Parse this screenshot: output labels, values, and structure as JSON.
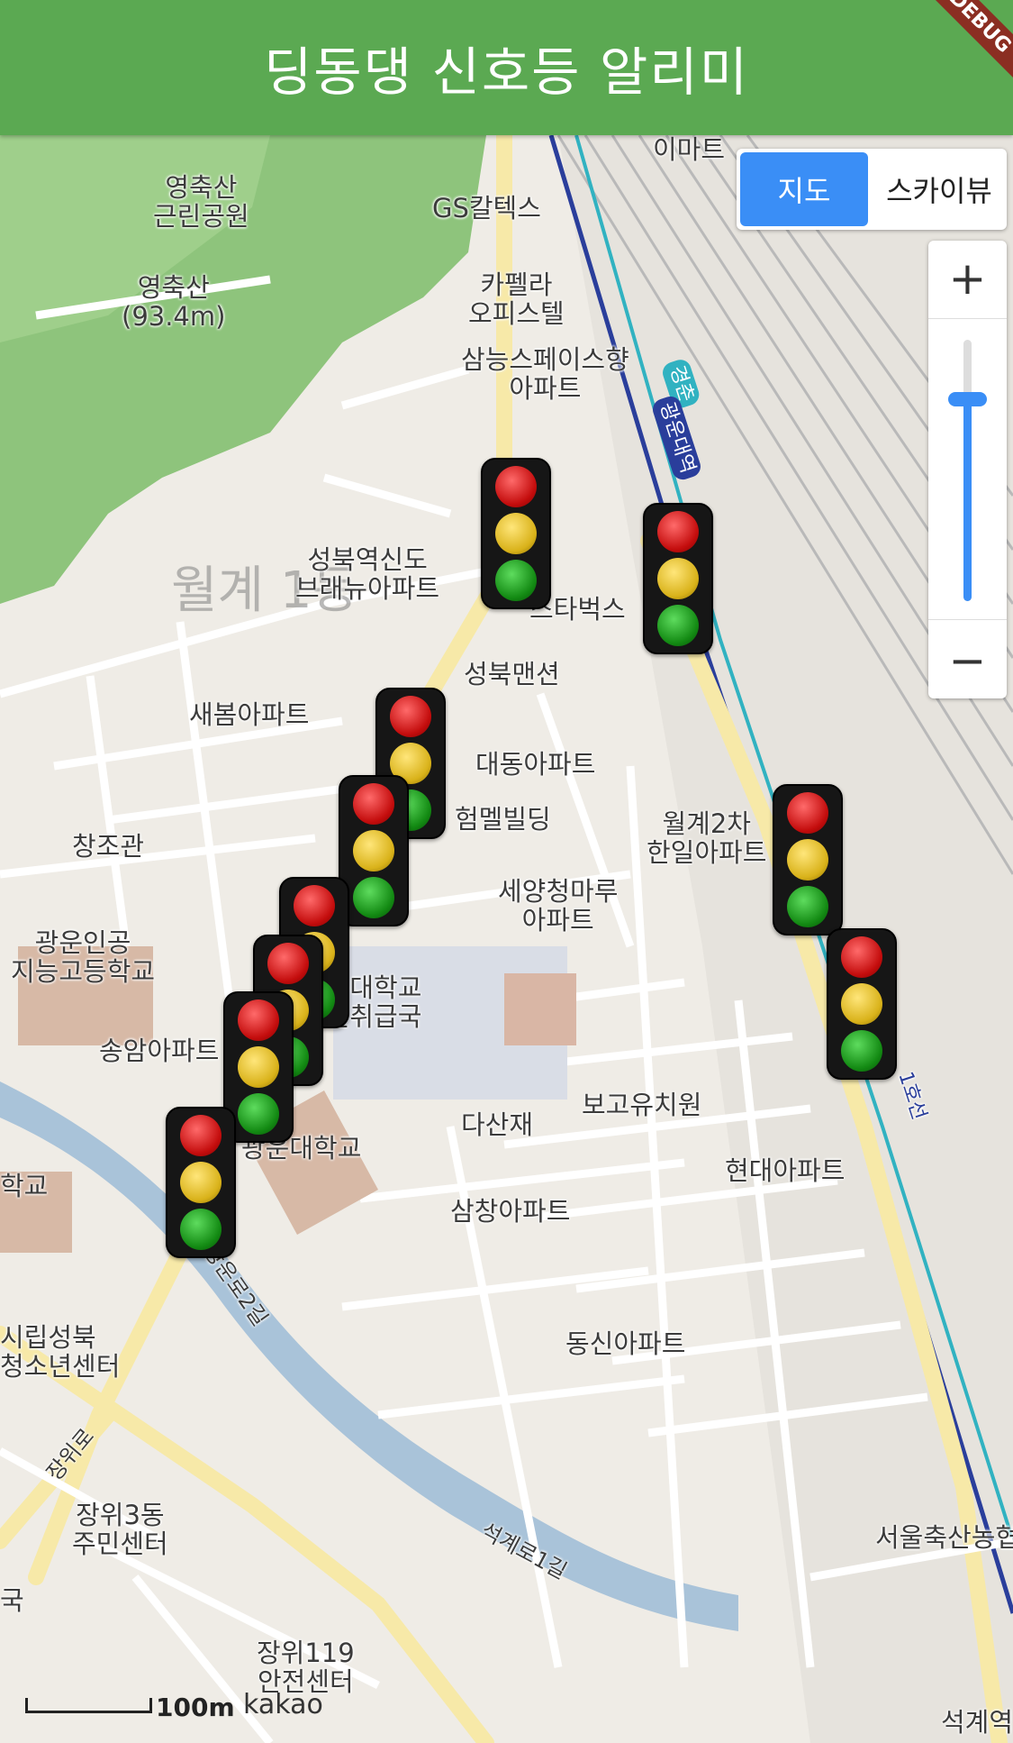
{
  "app": {
    "title": "딩동댕 신호등 알리미",
    "debug_banner": "DEBUG"
  },
  "map_type": {
    "map_label": "지도",
    "skyview_label": "스카이뷰",
    "active": "지도"
  },
  "zoom": {
    "plus": "+",
    "minus": "−"
  },
  "places": [
    {
      "id": "emart",
      "text": "이마트"
    },
    {
      "id": "young-park",
      "text": "영축산\n근린공원"
    },
    {
      "id": "gs",
      "text": "GS칼텍스"
    },
    {
      "id": "young-mt",
      "text": "영축산\n(93.4m)"
    },
    {
      "id": "cafe",
      "text": "카펠라\n오피스텔"
    },
    {
      "id": "samsung",
      "text": "삼능스페이스향\n아파트"
    },
    {
      "id": "brenew",
      "text": "성북역신도\n브래뉴아파트"
    },
    {
      "id": "starbucks",
      "text": "스타벅스"
    },
    {
      "id": "mansion",
      "text": "성북맨션"
    },
    {
      "id": "saebom",
      "text": "새봄아파트"
    },
    {
      "id": "daedong",
      "text": "대동아파트"
    },
    {
      "id": "hummel",
      "text": "험멜빌딩"
    },
    {
      "id": "wolgye2",
      "text": "월계2차\n한일아파트"
    },
    {
      "id": "changjo",
      "text": "창조관"
    },
    {
      "id": "seyang",
      "text": "세양청마루\n아파트"
    },
    {
      "id": "kwangwoon-ai",
      "text": "광운인공\n지능고등학교"
    },
    {
      "id": "kw-post",
      "text": "광운대학교\n우편취급국"
    },
    {
      "id": "songam",
      "text": "송암아파트"
    },
    {
      "id": "kw-univ",
      "text": "광운대학교"
    },
    {
      "id": "dasan",
      "text": "다산재"
    },
    {
      "id": "bogo",
      "text": "보고유치원"
    },
    {
      "id": "school",
      "text": "학교"
    },
    {
      "id": "hyundai",
      "text": "현대아파트"
    },
    {
      "id": "samchang",
      "text": "삼창아파트"
    },
    {
      "id": "seongbuk-youth",
      "text": "시립성북\n청소년센터"
    },
    {
      "id": "dongshin",
      "text": "동신아파트"
    },
    {
      "id": "jangwi-road",
      "text": "장위로"
    },
    {
      "id": "jangwi3",
      "text": "장위3동\n주민센터"
    },
    {
      "id": "seokgye",
      "text": "석계로1길"
    },
    {
      "id": "kwangwoon-ro",
      "text": "광운로2길"
    },
    {
      "id": "chuksan",
      "text": "서울축산농협"
    },
    {
      "id": "guk",
      "text": "국"
    },
    {
      "id": "jangwi119",
      "text": "장위119\n안전센터"
    },
    {
      "id": "seokgye-stn",
      "text": "석계역"
    },
    {
      "id": "wolgye-dong",
      "text": "월계 1동"
    },
    {
      "id": "gyeongchun",
      "text": "경춘"
    },
    {
      "id": "kw-stn",
      "text": "광운대역"
    },
    {
      "id": "line1",
      "text": "1호선"
    }
  ],
  "scale": {
    "text": "100m"
  },
  "attribution": "kakao",
  "traffic_lights": [
    {
      "id": "tl-1",
      "lamps": [
        "red",
        "yellow",
        "green"
      ]
    },
    {
      "id": "tl-2",
      "lamps": [
        "red",
        "yellow",
        "green"
      ]
    },
    {
      "id": "tl-3",
      "lamps": [
        "red",
        "yellow",
        "green"
      ]
    },
    {
      "id": "tl-4",
      "lamps": [
        "red",
        "yellow",
        "green"
      ]
    },
    {
      "id": "tl-5",
      "lamps": [
        "red",
        "yellow",
        "green"
      ]
    },
    {
      "id": "tl-6",
      "lamps": [
        "red",
        "yellow",
        "green"
      ]
    },
    {
      "id": "tl-7",
      "lamps": [
        "red",
        "yellow",
        "green"
      ]
    },
    {
      "id": "tl-8",
      "lamps": [
        "red",
        "yellow",
        "green"
      ]
    },
    {
      "id": "tl-9",
      "lamps": [
        "red",
        "yellow",
        "green"
      ]
    },
    {
      "id": "tl-10",
      "lamps": [
        "red",
        "yellow",
        "green"
      ]
    }
  ],
  "colors": {
    "appbar": "#5ba952",
    "accent": "#3a8ef6",
    "park": "#8ec47c",
    "water": "#a9c3d9",
    "road": "#ffffff",
    "main_road": "#f7e9a8"
  }
}
